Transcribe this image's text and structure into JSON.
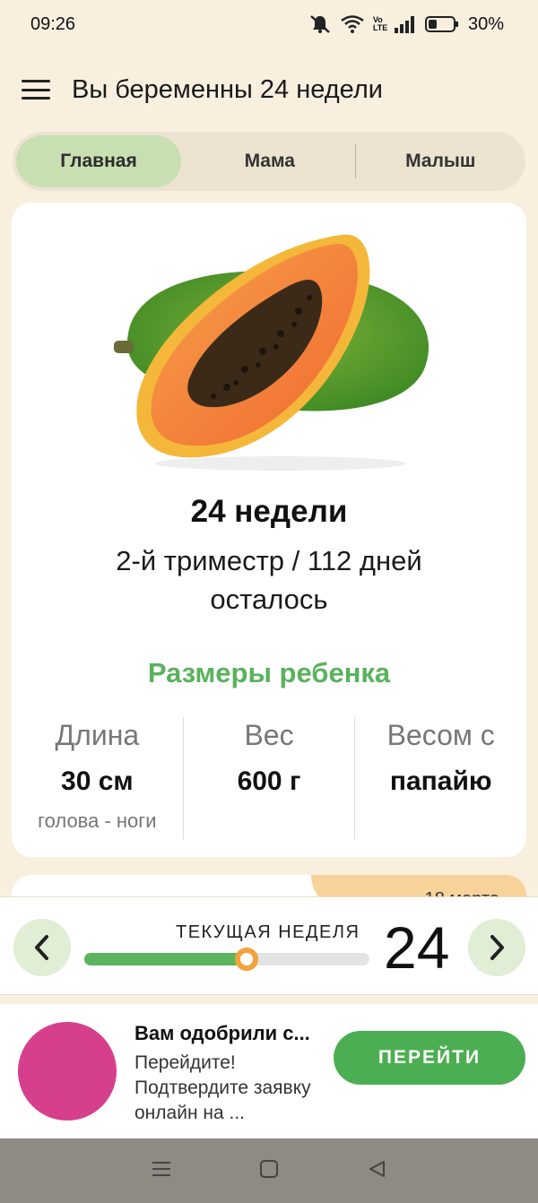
{
  "status": {
    "time": "09:26",
    "battery": "30%",
    "icons": [
      "mute-icon",
      "wifi-icon",
      "volte-icon",
      "signal-icon",
      "battery-icon"
    ],
    "volte_text": "Vo LTE"
  },
  "app_bar": {
    "title": "Вы беременны 24 недели"
  },
  "tabs": [
    {
      "label": "Главная",
      "active": true
    },
    {
      "label": "Мама",
      "active": false
    },
    {
      "label": "Малыш",
      "active": false
    }
  ],
  "week_card": {
    "title": "24 недели",
    "trimester": "2-й триместр / 112 дней осталось",
    "sizes_title": "Размеры ребенка",
    "sizes": [
      {
        "label": "Длина",
        "value": "30 см",
        "note": "голова - ноги"
      },
      {
        "label": "Вес",
        "value": "600 г",
        "note": ""
      },
      {
        "label": "Весом с",
        "value": "папайю",
        "note": ""
      }
    ],
    "image": "papaya"
  },
  "next_card": {
    "date": "18 марта"
  },
  "week_bar": {
    "label": "ТЕКУЩАЯ НЕДЕЛЯ",
    "week": "24",
    "progress": 0.57
  },
  "ad": {
    "title": "Вам одобрили с...",
    "text": "Перейдите! Подтвердите заявку онлайн на ...",
    "button": "ПЕРЕЙТИ"
  },
  "colors": {
    "background": "#f8efdf",
    "accent_green": "#59b25c",
    "tab_active": "#c8dfb1",
    "progress_thumb": "#f2a23a",
    "ad_avatar": "#d63f8b"
  }
}
